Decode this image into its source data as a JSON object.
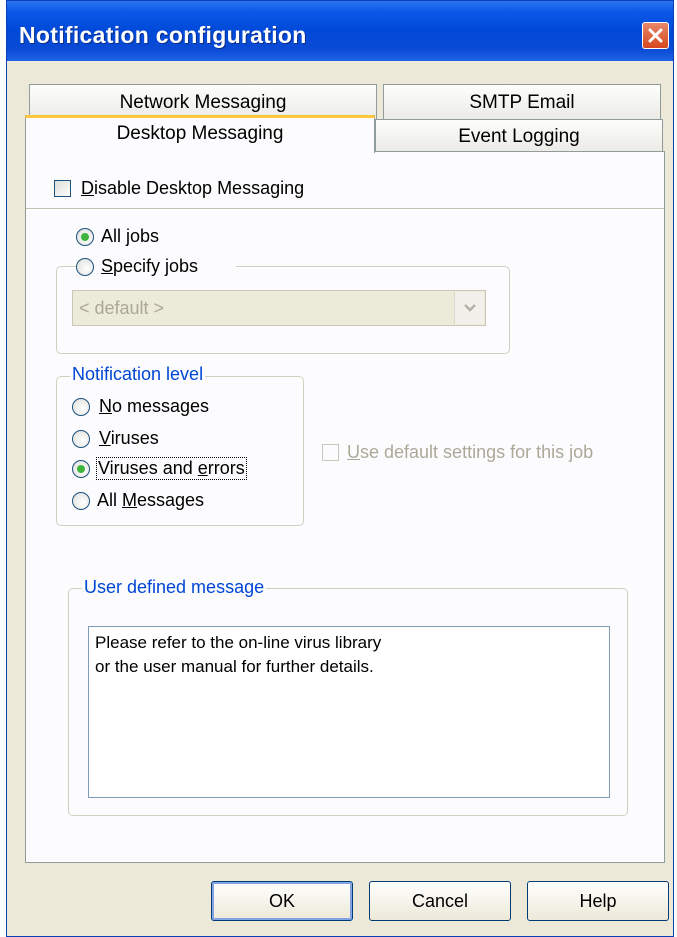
{
  "window": {
    "title": "Notification configuration"
  },
  "tabs": {
    "network_messaging": "Network Messaging",
    "smtp_email": "SMTP Email",
    "desktop_messaging": "Desktop Messaging",
    "event_logging": "Event Logging",
    "active": "Desktop Messaging"
  },
  "desktop": {
    "disable_checkbox": {
      "prefix": "",
      "accel": "D",
      "rest": "isable Desktop Messaging",
      "checked": false
    },
    "jobs": {
      "all_jobs": {
        "prefix": "All ",
        "accel": "j",
        "rest": "obs",
        "selected": true
      },
      "specify_jobs": {
        "prefix": "",
        "accel": "S",
        "rest": "pecify jobs",
        "selected": false
      },
      "job_select_value": "< default >"
    },
    "notification_level": {
      "legend": "Notification level",
      "no_messages": {
        "prefix": "",
        "accel": "N",
        "rest": "o messages",
        "selected": false
      },
      "viruses": {
        "prefix": "",
        "accel": "V",
        "rest": "iruses",
        "selected": false
      },
      "viruses_and_errors": {
        "prefix": "Viruses and ",
        "accel": "e",
        "rest": "rrors",
        "selected": true
      },
      "all_messages": {
        "prefix": "All ",
        "accel": "M",
        "rest": "essages",
        "selected": false
      }
    },
    "use_default": {
      "prefix": "",
      "accel": "U",
      "rest": "se default settings for this job",
      "checked": false,
      "disabled": true
    },
    "user_message": {
      "legend": "User defined message",
      "line1": "Please refer to the on-line virus library",
      "line2": "or the user manual for further details."
    }
  },
  "buttons": {
    "ok": "OK",
    "cancel": "Cancel",
    "help": "Help"
  },
  "colors": {
    "titlebar": "#0049d8",
    "group_legend": "#0046d5",
    "radio_dot": "#3db53d",
    "active_tab_highlight": "#ffc83c"
  }
}
